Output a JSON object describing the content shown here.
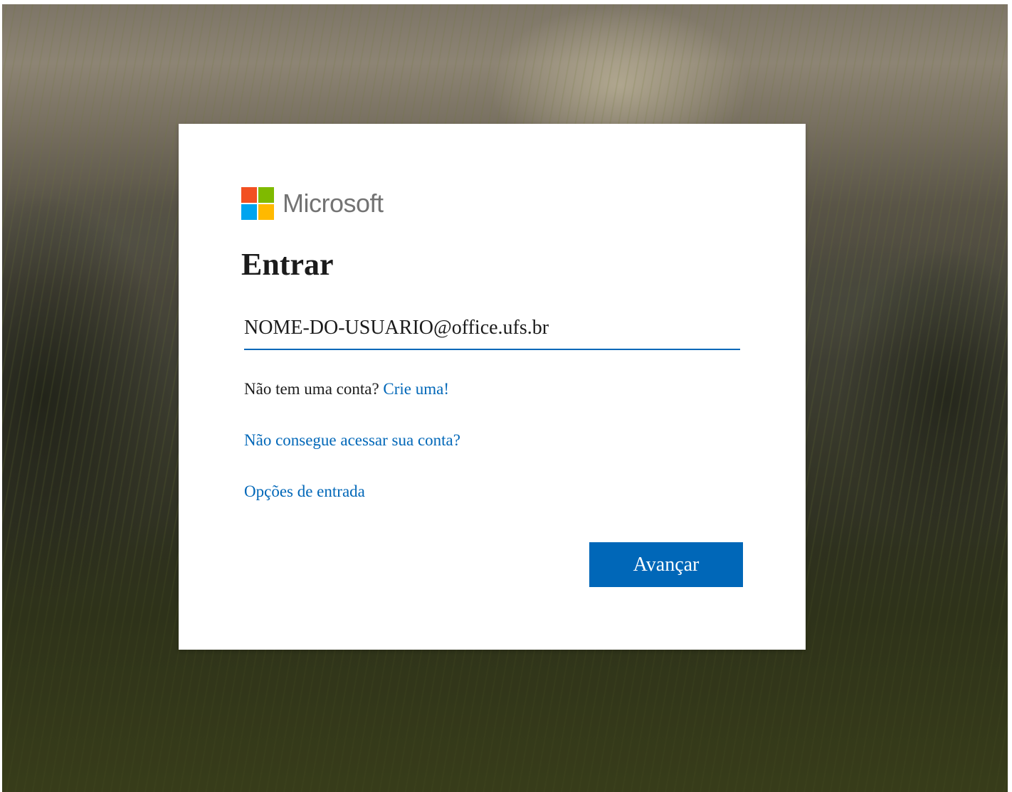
{
  "background": {
    "description_icon": "landscape-background"
  },
  "brand": {
    "name": "Microsoft",
    "logo_colors": [
      "#f25022",
      "#7fba00",
      "#00a4ef",
      "#ffb900"
    ]
  },
  "signin": {
    "title": "Entrar",
    "email_value": "NOME-DO-USUARIO@office.ufs.br",
    "no_account_text": "Não tem uma conta?",
    "create_account_link": "Crie uma!",
    "cant_access_link": "Não consegue acessar sua conta?",
    "signin_options_link": "Opções de entrada",
    "next_button": "Avançar"
  },
  "colors": {
    "accent": "#0067b8",
    "text": "#1b1b1b",
    "logo_text": "#737373"
  }
}
